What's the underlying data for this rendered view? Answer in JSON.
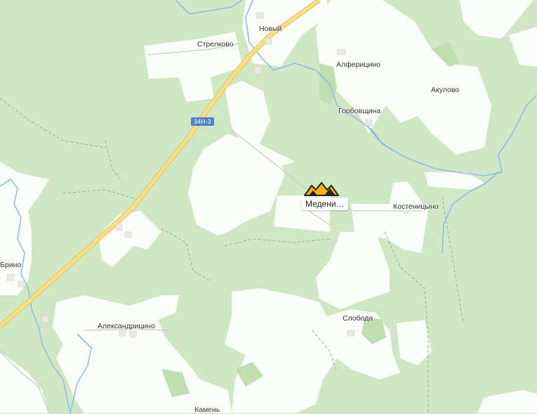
{
  "map": {
    "road_number": "34Н-3",
    "poi": {
      "label": "Медени…",
      "icon": "quarry-icon",
      "color": "#f5b400"
    },
    "places": [
      {
        "id": "noviy",
        "name": "Новый"
      },
      {
        "id": "strelkovo",
        "name": "Стрелково"
      },
      {
        "id": "alfericino",
        "name": "Алферицино"
      },
      {
        "id": "akulovo",
        "name": "Акулово"
      },
      {
        "id": "gorbovshchina",
        "name": "Горбовщина"
      },
      {
        "id": "kostenitsyno",
        "name": "Костеницыно"
      },
      {
        "id": "brino",
        "name": "Брино"
      },
      {
        "id": "aleksandricino",
        "name": "Александрицино"
      },
      {
        "id": "sloboda",
        "name": "Слобода"
      },
      {
        "id": "kamen",
        "name": "Камень"
      }
    ],
    "colors": {
      "forest": "#cfe8c3",
      "field": "#ffffff",
      "road": "#f6d87a",
      "water": "#7fb4e6"
    }
  }
}
